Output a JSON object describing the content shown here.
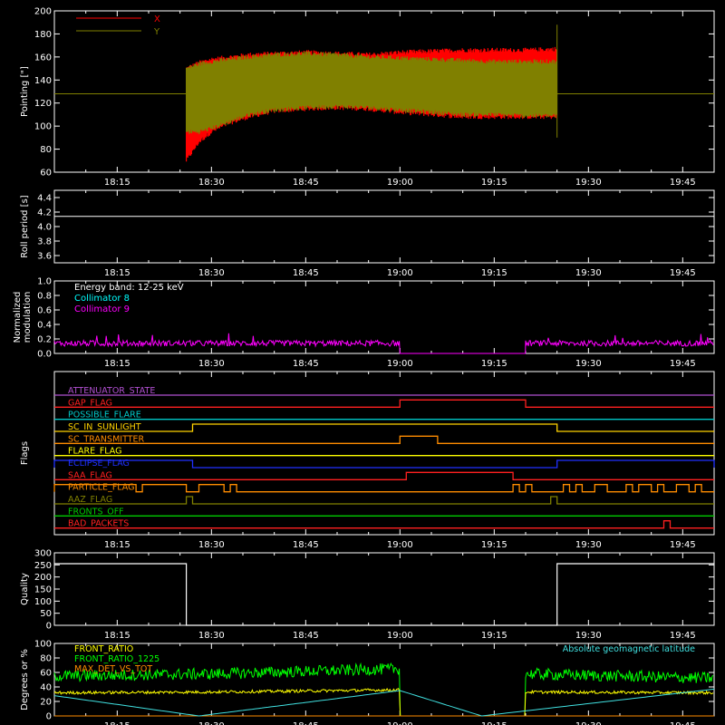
{
  "xaxis": {
    "start": "18:05",
    "end": "19:50",
    "ticks": [
      "18:15",
      "18:30",
      "18:45",
      "19:00",
      "19:15",
      "19:30",
      "19:45"
    ]
  },
  "chart_data": [
    {
      "id": "pointing",
      "type": "line",
      "ylabel": "Pointing [\"]",
      "ylim": [
        60,
        200
      ],
      "yticks": [
        "60",
        "80",
        "100",
        "120",
        "140",
        "160",
        "180",
        "200"
      ],
      "legend": [
        {
          "name": "X",
          "color": "#ff0000"
        },
        {
          "name": "Y",
          "color": "#808000"
        }
      ],
      "baseline": 128,
      "data_start": "18:26",
      "data_end": "19:25",
      "series": [
        {
          "name": "X",
          "color": "#ff0000",
          "x": [
            "18:26",
            "18:28",
            "18:30",
            "18:33",
            "18:36",
            "18:40",
            "18:45",
            "18:50",
            "18:55",
            "19:00",
            "19:05",
            "19:10",
            "19:15",
            "19:20",
            "19:25"
          ],
          "high": [
            150,
            155,
            158,
            160,
            162,
            163,
            164,
            163,
            162,
            164,
            165,
            166,
            166,
            166,
            167
          ],
          "low": [
            70,
            86,
            95,
            103,
            108,
            113,
            115,
            116,
            115,
            112,
            110,
            108,
            108,
            108,
            108
          ]
        },
        {
          "name": "Y",
          "color": "#808000",
          "x": [
            "18:26",
            "18:28",
            "18:30",
            "18:33",
            "18:36",
            "18:40",
            "18:45",
            "18:50",
            "18:55",
            "19:00",
            "19:05",
            "19:10",
            "19:15",
            "19:20",
            "19:25"
          ],
          "high": [
            150,
            154,
            156,
            158,
            160,
            162,
            163,
            162,
            160,
            159,
            158,
            157,
            156,
            156,
            156
          ],
          "low": [
            95,
            95,
            98,
            104,
            110,
            114,
            116,
            117,
            116,
            114,
            112,
            110,
            110,
            109,
            109
          ]
        }
      ]
    },
    {
      "id": "roll",
      "type": "line",
      "ylabel": "Roll period [s]",
      "ylim": [
        3.5,
        4.5
      ],
      "yticks": [
        "3.6",
        "3.8",
        "4.0",
        "4.2",
        "4.4"
      ],
      "series": [
        {
          "name": "Roll period",
          "color": "#ffffff",
          "x": [
            "18:05",
            "19:50"
          ],
          "y": [
            4.14,
            4.14
          ]
        }
      ]
    },
    {
      "id": "modulation",
      "type": "line",
      "ylabel": [
        "Normalized",
        "modulation"
      ],
      "ylim": [
        0,
        1
      ],
      "yticks": [
        "0.0",
        "0.2",
        "0.4",
        "0.6",
        "0.8",
        "1.0"
      ],
      "legend": [
        {
          "name": "Energy band: 12-25 keV",
          "color": "#ffffff"
        },
        {
          "name": "Collimator 8",
          "color": "#00ffff"
        },
        {
          "name": "Collimator 9",
          "color": "#ff00ff"
        }
      ],
      "series": [
        {
          "name": "Collimator 9",
          "color": "#ff00ff",
          "segments": [
            {
              "x": [
                "18:05",
                "19:00"
              ],
              "level": 0.14,
              "noise": 0.04
            },
            {
              "x": [
                "19:00",
                "19:20"
              ],
              "level": 0.0,
              "noise": 0
            },
            {
              "x": [
                "19:20",
                "19:50"
              ],
              "level": 0.14,
              "noise": 0.04
            }
          ]
        }
      ]
    },
    {
      "id": "flags",
      "type": "step",
      "ylabel": "Flags",
      "flags": [
        {
          "name": "ATTENUATOR_STATE",
          "color": "#b04fd0",
          "high": []
        },
        {
          "name": "GAP_FLAG",
          "color": "#ff2020",
          "high": [
            [
              "19:00",
              "19:20"
            ]
          ]
        },
        {
          "name": "POSSIBLE_FLARE",
          "color": "#00c8c8",
          "high": []
        },
        {
          "name": "SC_IN_SUNLIGHT",
          "color": "#ffd400",
          "high": [
            [
              "18:27",
              "19:25"
            ]
          ]
        },
        {
          "name": "SC_TRANSMITTER",
          "color": "#ff8c00",
          "high": [
            [
              "19:00",
              "19:06"
            ]
          ]
        },
        {
          "name": "FLARE_FLAG",
          "color": "#ffff00",
          "high": []
        },
        {
          "name": "ECLIPSE_FLAG",
          "color": "#2030ff",
          "high": [
            [
              "18:05",
              "18:27"
            ],
            [
              "19:25",
              "19:50"
            ]
          ]
        },
        {
          "name": "SAA_FLAG",
          "color": "#ff2020",
          "high": [
            [
              "19:01",
              "19:18"
            ]
          ]
        },
        {
          "name": "PARTICLE_FLAG",
          "color": "#ff8c00",
          "high": [
            [
              "18:05",
              "18:18"
            ],
            [
              "18:19",
              "18:26"
            ],
            [
              "18:28",
              "18:32"
            ],
            [
              "18:33",
              "18:34"
            ],
            [
              "19:18",
              "19:19"
            ],
            [
              "19:20",
              "19:21"
            ],
            [
              "19:26",
              "19:27"
            ],
            [
              "19:28",
              "19:29"
            ],
            [
              "19:31",
              "19:33"
            ],
            [
              "19:36",
              "19:37"
            ],
            [
              "19:38",
              "19:40"
            ],
            [
              "19:41",
              "19:42"
            ],
            [
              "19:44",
              "19:46"
            ],
            [
              "19:47",
              "19:48"
            ]
          ]
        },
        {
          "name": "AAZ_FLAG",
          "color": "#808000",
          "high": [
            [
              "18:26",
              "18:27"
            ],
            [
              "19:24",
              "19:25"
            ]
          ]
        },
        {
          "name": "FRONTS_OFF",
          "color": "#00cc00",
          "high": []
        },
        {
          "name": "BAD_PACKETS",
          "color": "#ff2020",
          "high": [
            [
              "19:42",
              "19:43"
            ]
          ]
        }
      ]
    },
    {
      "id": "quality",
      "type": "step",
      "ylabel": "Quality",
      "ylim": [
        0,
        300
      ],
      "yticks": [
        "0",
        "50",
        "100",
        "150",
        "200",
        "250",
        "300"
      ],
      "series": [
        {
          "name": "Quality",
          "color": "#ffffff",
          "x": [
            "18:05",
            "18:26",
            "18:26",
            "19:25",
            "19:25",
            "19:50"
          ],
          "y": [
            255,
            255,
            0,
            0,
            255,
            255
          ]
        }
      ]
    },
    {
      "id": "ratios",
      "type": "line",
      "ylabel": "Degrees or %",
      "ylim": [
        0,
        100
      ],
      "yticks": [
        "0",
        "20",
        "40",
        "60",
        "80",
        "100"
      ],
      "legend_left": [
        {
          "name": "FRONT_RATIO",
          "color": "#ffff00"
        },
        {
          "name": "FRONT_RATIO_1225",
          "color": "#00ff00"
        },
        {
          "name": "MAX_DET_VS_TOT",
          "color": "#ff8c00"
        }
      ],
      "legend_right": [
        {
          "name": "Absolute geomagnetic latitude",
          "color": "#40e0e0"
        }
      ],
      "series": [
        {
          "name": "FRONT_RATIO_1225",
          "color": "#00ff00",
          "x": [
            "18:05",
            "18:30",
            "19:00",
            "19:00",
            "19:20",
            "19:20",
            "19:50"
          ],
          "y": [
            55,
            58,
            65,
            0,
            0,
            58,
            52
          ],
          "noise": 8
        },
        {
          "name": "FRONT_RATIO",
          "color": "#ffff00",
          "x": [
            "18:05",
            "18:30",
            "19:00",
            "19:00",
            "19:20",
            "19:20",
            "19:50"
          ],
          "y": [
            32,
            33,
            36,
            0,
            0,
            33,
            32
          ],
          "noise": 2
        },
        {
          "name": "MAX_DET_VS_TOT",
          "color": "#ff8c00",
          "x": [
            "18:05",
            "19:50"
          ],
          "y": [
            0,
            0
          ],
          "noise": 0
        },
        {
          "name": "Absolute geomagnetic latitude",
          "color": "#40e0e0",
          "x": [
            "18:05",
            "18:28",
            "19:00",
            "19:13",
            "19:50"
          ],
          "y": [
            28,
            0,
            35,
            0,
            37
          ],
          "noise": 0
        }
      ]
    }
  ]
}
